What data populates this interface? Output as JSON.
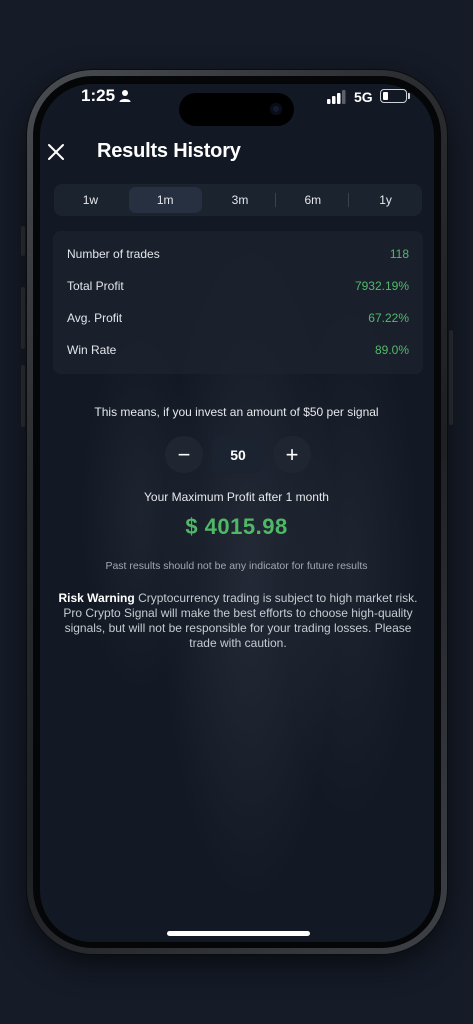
{
  "status_bar": {
    "time": "1:25",
    "network": "5G"
  },
  "header": {
    "title": "Results History"
  },
  "tabs": [
    {
      "label": "1w"
    },
    {
      "label": "1m"
    },
    {
      "label": "3m"
    },
    {
      "label": "6m"
    },
    {
      "label": "1y"
    }
  ],
  "stats": [
    {
      "label": "Number of trades",
      "value": "118"
    },
    {
      "label": "Total Profit",
      "value": "7932.19%"
    },
    {
      "label": "Avg. Profit",
      "value": "67.22%"
    },
    {
      "label": "Win Rate",
      "value": "89.0%"
    }
  ],
  "calculator": {
    "means_text": "This means, if you invest an amount of $50 per signal",
    "minus": "−",
    "plus": "+",
    "amount_value": "50",
    "max_profit_label": "Your Maximum Profit after 1 month",
    "max_profit_value": "$ 4015.98"
  },
  "disclaimer": "Past results should not be any indicator for future results",
  "risk": {
    "title": "Risk Warning",
    "text": "Cryptocurrency trading is subject to high market risk. Pro Crypto Signal will make the best efforts to choose high-quality signals, but will not be responsible for your trading losses. Please trade with caution."
  },
  "colors": {
    "accent_green": "#52b96a",
    "background": "#131924"
  },
  "icons": [
    "person-icon",
    "signal-icon",
    "battery-icon",
    "close-icon",
    "minus-icon",
    "plus-icon"
  ]
}
